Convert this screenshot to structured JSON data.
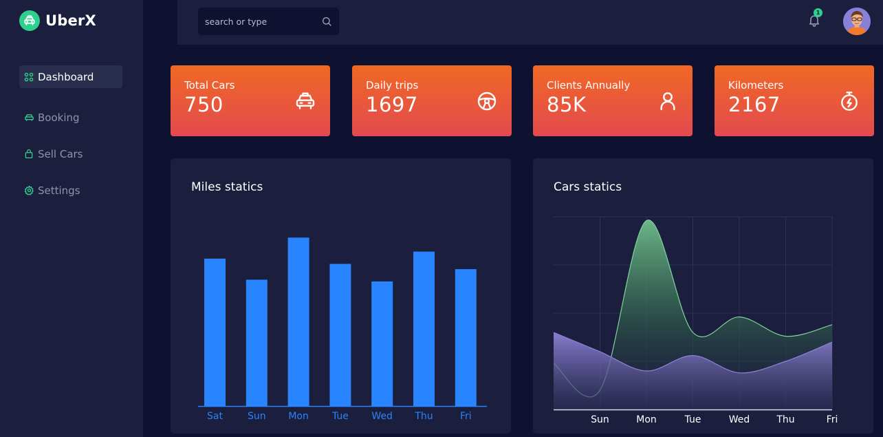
{
  "brand": {
    "name": "UberX",
    "icon": "taxi-icon"
  },
  "sidebar": {
    "items": [
      {
        "label": "Dashboard",
        "icon": "grid-icon",
        "active": true
      },
      {
        "label": "Booking",
        "icon": "car-icon",
        "active": false
      },
      {
        "label": "Sell Cars",
        "icon": "bag-icon",
        "active": false
      },
      {
        "label": "Settings",
        "icon": "gear-icon",
        "active": false
      }
    ]
  },
  "topbar": {
    "search_placeholder": "search or type",
    "notification_count": "1"
  },
  "stats": [
    {
      "title": "Total Cars",
      "value": "750",
      "icon": "taxi-icon"
    },
    {
      "title": "Daily trips",
      "value": "1697",
      "icon": "steering-wheel-icon"
    },
    {
      "title": "Clients Annually",
      "value": "85K",
      "icon": "user-icon"
    },
    {
      "title": "Kilometers",
      "value": "2167",
      "icon": "stopwatch-icon"
    }
  ],
  "colors": {
    "accent": "#2ed08e",
    "bar": "#2884ff",
    "card_top": "#f06824",
    "card_bottom": "#e34a4f",
    "green_series": "#7fd49a",
    "purple_series": "#8f82d8"
  },
  "miles_panel": {
    "title": "Miles statics"
  },
  "cars_panel": {
    "title": "Cars statics"
  },
  "chart_data": [
    {
      "type": "bar",
      "title": "Miles statics",
      "categories": [
        "Sat",
        "Sun",
        "Mon",
        "Tue",
        "Wed",
        "Thu",
        "Fri"
      ],
      "values": [
        84,
        72,
        96,
        81,
        71,
        88,
        78
      ],
      "ylim": [
        0,
        100
      ],
      "grid": false
    },
    {
      "type": "area",
      "title": "Cars statics",
      "x": [
        "",
        "Sun",
        "Mon",
        "Tue",
        "Wed",
        "Thu",
        "Fri"
      ],
      "ylim": [
        0,
        100
      ],
      "grid": true,
      "series": [
        {
          "values": [
            24,
            10,
            98,
            40,
            48,
            38,
            44
          ]
        },
        {
          "values": [
            40,
            30,
            20,
            28,
            19,
            25,
            35
          ]
        }
      ]
    }
  ]
}
